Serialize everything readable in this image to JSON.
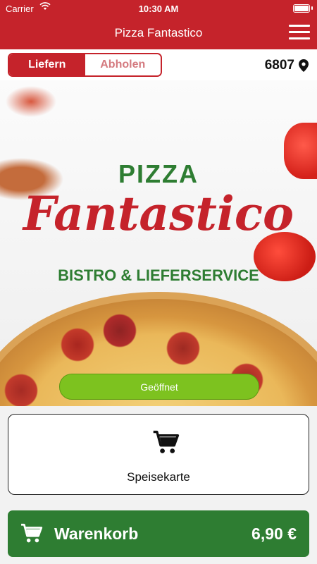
{
  "statusbar": {
    "carrier": "Carrier",
    "time": "10:30 AM"
  },
  "navbar": {
    "title": "Pizza Fantastico"
  },
  "mode": {
    "deliver": "Liefern",
    "pickup": "Abholen",
    "postal_code": "6807"
  },
  "logo": {
    "top": "PIZZA",
    "main": "Fantastico",
    "sub": "BISTRO & LIEFERSERVICE"
  },
  "status": {
    "open": "Geöffnet"
  },
  "menu": {
    "label": "Speisekarte"
  },
  "basket": {
    "label": "Warenkorb",
    "total": "6,90 €"
  },
  "colors": {
    "brand_red": "#c5232b",
    "brand_green": "#2e7d32",
    "open_green": "#7dc21f"
  },
  "icons": [
    "wifi-icon",
    "battery-icon",
    "hamburger-menu-icon",
    "location-pin-icon",
    "cart-icon"
  ]
}
